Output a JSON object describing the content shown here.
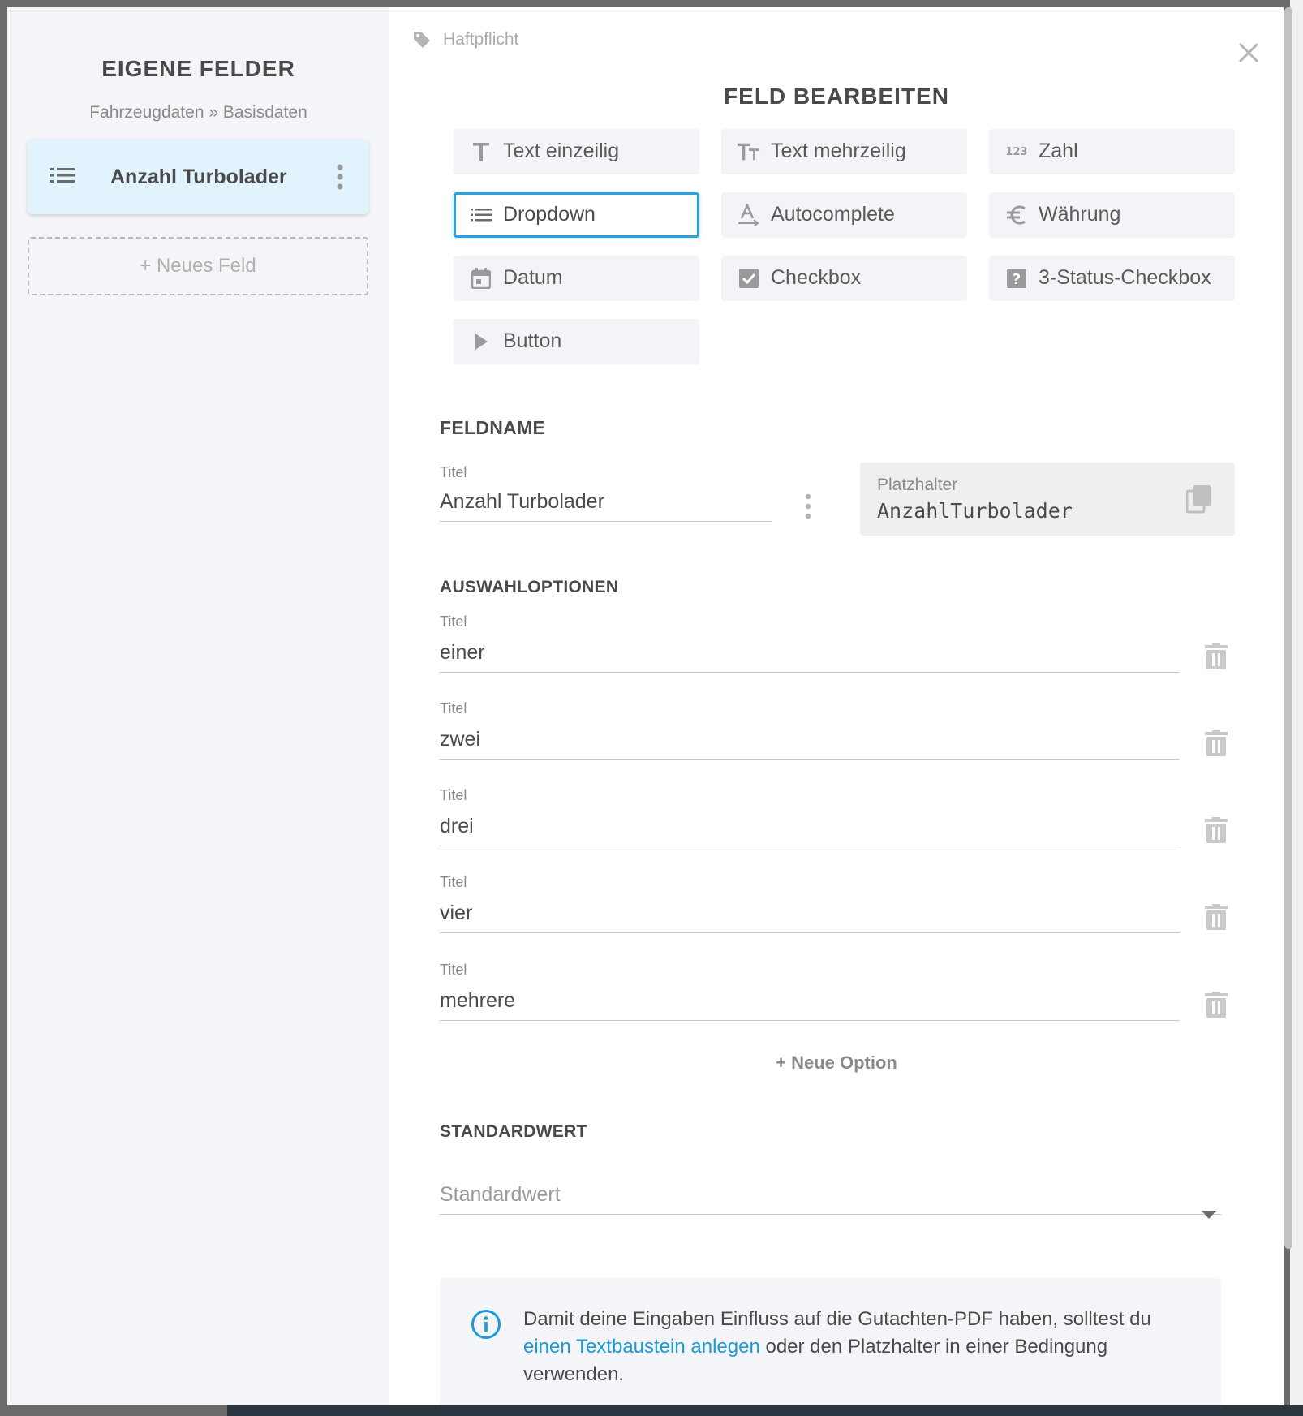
{
  "sidebar": {
    "title": "EIGENE FELDER",
    "breadcrumb": "Fahrzeugdaten » Basisdaten",
    "active_field": "Anzahl Turbolader",
    "new_field_label": "+ Neues Feld"
  },
  "main": {
    "tag_label": "Haftpflicht",
    "title": "FELD BEARBEITEN",
    "field_types": [
      {
        "label": "Text einzeilig",
        "icon": "text-t-icon"
      },
      {
        "label": "Text mehrzeilig",
        "icon": "text-multiline-icon"
      },
      {
        "label": "Zahl",
        "icon": "number-123-icon"
      },
      {
        "label": "Dropdown",
        "icon": "list-icon",
        "selected": true
      },
      {
        "label": "Autocomplete",
        "icon": "autocomplete-icon"
      },
      {
        "label": "Währung",
        "icon": "euro-icon"
      },
      {
        "label": "Datum",
        "icon": "calendar-icon"
      },
      {
        "label": "Checkbox",
        "icon": "checkbox-icon"
      },
      {
        "label": "3-Status-Checkbox",
        "icon": "question-box-icon"
      },
      {
        "label": "Button",
        "icon": "play-icon"
      }
    ],
    "number_icon_text": "123",
    "fieldname": {
      "heading": "FELDNAME",
      "title_label": "Titel",
      "title_value": "Anzahl Turbolader",
      "placeholder_label": "Platzhalter",
      "placeholder_value": "AnzahlTurbolader"
    },
    "options": {
      "heading": "AUSWAHLOPTIONEN",
      "items": [
        {
          "label": "Titel",
          "value": "einer"
        },
        {
          "label": "Titel",
          "value": "zwei"
        },
        {
          "label": "Titel",
          "value": "drei"
        },
        {
          "label": "Titel",
          "value": "vier"
        },
        {
          "label": "Titel",
          "value": "mehrere"
        }
      ],
      "new_option_label": "+ Neue Option"
    },
    "default_value": {
      "heading": "STANDARDWERT",
      "placeholder": "Standardwert"
    },
    "info": {
      "text_before": "Damit deine Eingaben Einfluss auf die Gutachten-PDF haben, solltest du ",
      "link_text": "einen Textbaustein anlegen",
      "text_after": " oder den Platzhalter in einer Bedingung verwenden."
    }
  },
  "colors": {
    "accent": "#2aa0dc",
    "link": "#1d9ad6",
    "active_card": "#e1f3fc",
    "sidebar_bg": "#f3f5f8"
  }
}
